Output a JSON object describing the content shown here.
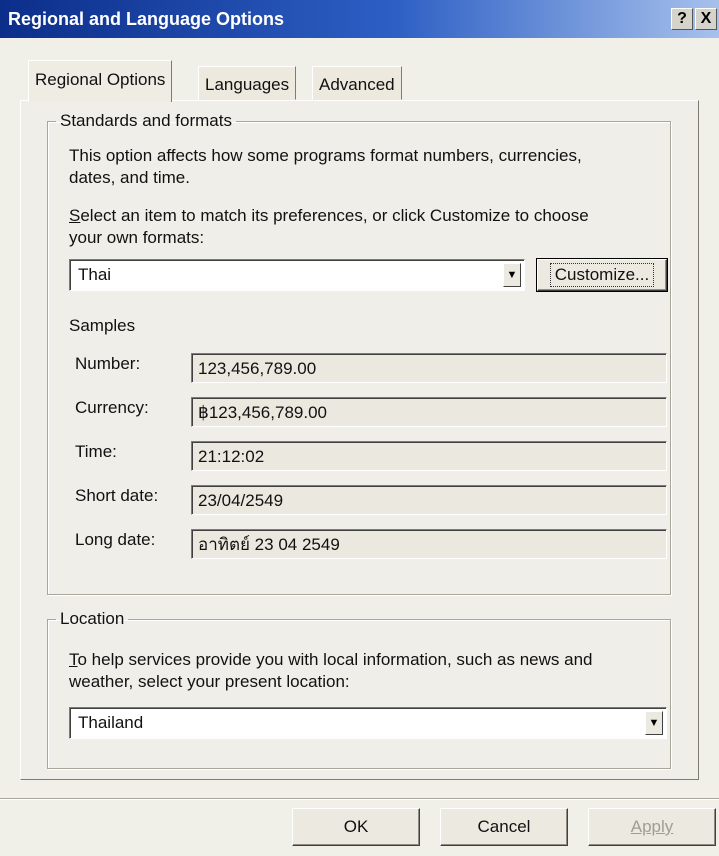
{
  "window": {
    "title": "Regional and Language Options",
    "help_label": "?",
    "close_label": "X"
  },
  "tabs": [
    {
      "label": "Regional Options",
      "active": true
    },
    {
      "label": "Languages",
      "active": false
    },
    {
      "label": "Advanced",
      "active": false
    }
  ],
  "standards": {
    "legend": "Standards and formats",
    "desc_line1": "This option affects how some programs format numbers, currencies,",
    "desc_line2": "dates, and time.",
    "select_pre": "S",
    "select_line1_rest": "elect an item to match its preferences, or click Customize to choose",
    "select_line2": "your own formats:",
    "format_value": "Thai",
    "customize_label": "Customize..."
  },
  "samples": {
    "title": "Samples",
    "rows": [
      {
        "label": "Number:",
        "value": "123,456,789.00"
      },
      {
        "label": "Currency:",
        "value": "฿123,456,789.00"
      },
      {
        "label": "Time:",
        "value": "21:12:02"
      },
      {
        "label": "Short date:",
        "value": "23/04/2549"
      },
      {
        "label": "Long date:",
        "value": "อาทิตย์ 23 04 2549"
      }
    ]
  },
  "location": {
    "legend": "Location",
    "desc_pre": "T",
    "desc_line1_rest": "o help services provide you with local information, such as news and",
    "desc_line2": "weather, select your present location:",
    "value": "Thailand"
  },
  "footer": {
    "ok_label": "OK",
    "cancel_label": "Cancel",
    "apply_label": "Apply"
  },
  "colors": {
    "title_bar": "#0c2e8a",
    "dialog_bg": "#f0efe8"
  }
}
